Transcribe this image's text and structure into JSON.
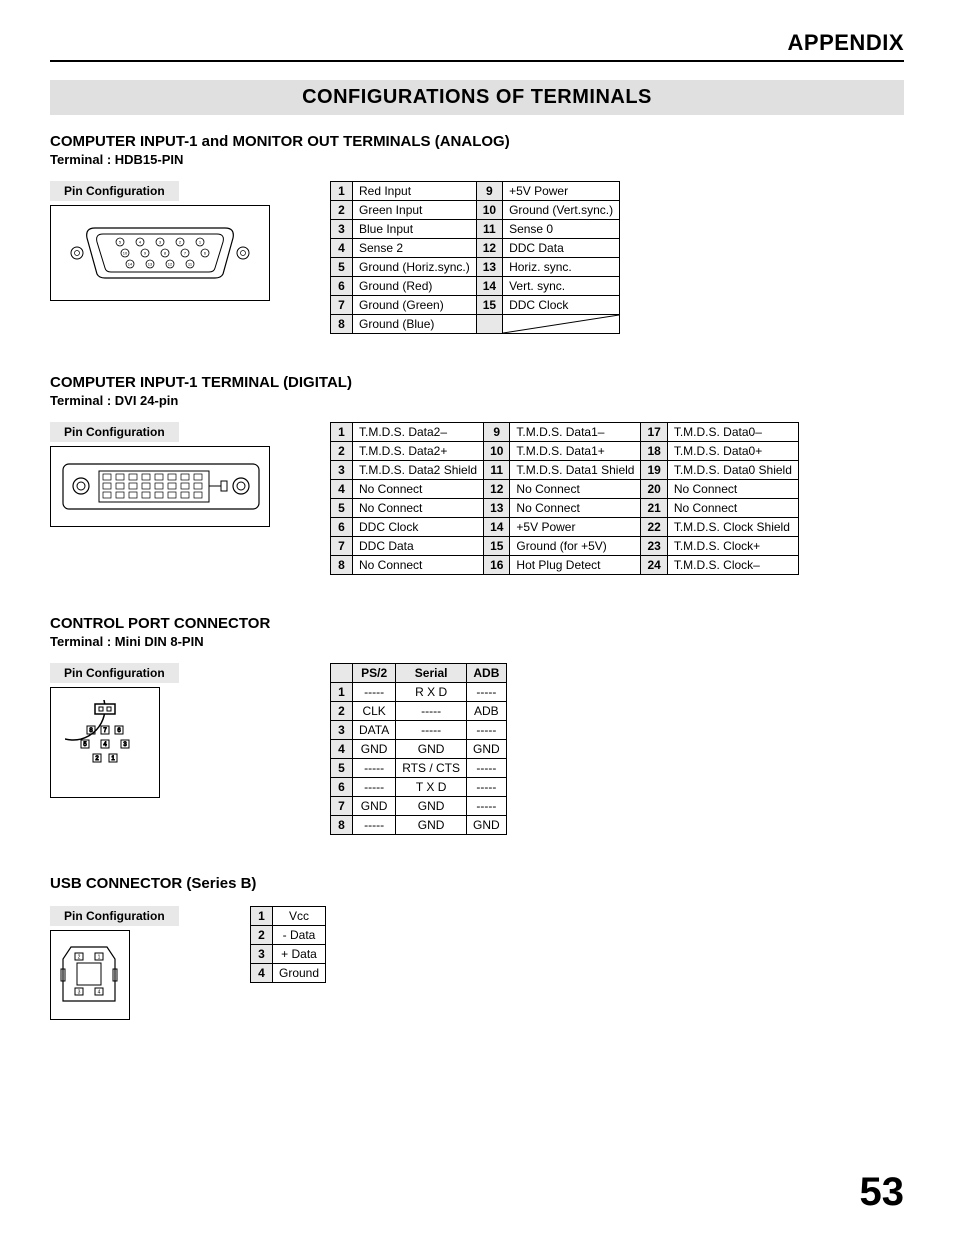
{
  "header": "APPENDIX",
  "main_title": "CONFIGURATIONS OF TERMINALS",
  "page_number": "53",
  "sections": {
    "analog": {
      "title": "COMPUTER INPUT-1 and MONITOR OUT TERMINALS (ANALOG)",
      "sub": "Terminal : HDB15-PIN",
      "config": "Pin Configuration",
      "pins_left": [
        {
          "n": "1",
          "v": "Red Input"
        },
        {
          "n": "2",
          "v": "Green Input"
        },
        {
          "n": "3",
          "v": "Blue Input"
        },
        {
          "n": "4",
          "v": "Sense 2"
        },
        {
          "n": "5",
          "v": "Ground (Horiz.sync.)"
        },
        {
          "n": "6",
          "v": "Ground (Red)"
        },
        {
          "n": "7",
          "v": "Ground (Green)"
        },
        {
          "n": "8",
          "v": "Ground (Blue)"
        }
      ],
      "pins_right": [
        {
          "n": "9",
          "v": "+5V Power"
        },
        {
          "n": "10",
          "v": "Ground (Vert.sync.)"
        },
        {
          "n": "11",
          "v": "Sense 0"
        },
        {
          "n": "12",
          "v": "DDC Data"
        },
        {
          "n": "13",
          "v": "Horiz. sync."
        },
        {
          "n": "14",
          "v": "Vert. sync."
        },
        {
          "n": "15",
          "v": "DDC Clock"
        }
      ]
    },
    "digital": {
      "title": "COMPUTER INPUT-1 TERMINAL (DIGITAL)",
      "sub": "Terminal : DVI 24-pin",
      "config": "Pin Configuration",
      "pins_a": [
        {
          "n": "1",
          "v": "T.M.D.S. Data2–"
        },
        {
          "n": "2",
          "v": "T.M.D.S. Data2+"
        },
        {
          "n": "3",
          "v": "T.M.D.S. Data2 Shield"
        },
        {
          "n": "4",
          "v": "No Connect"
        },
        {
          "n": "5",
          "v": "No Connect"
        },
        {
          "n": "6",
          "v": "DDC Clock"
        },
        {
          "n": "7",
          "v": "DDC Data"
        },
        {
          "n": "8",
          "v": "No Connect"
        }
      ],
      "pins_b": [
        {
          "n": "9",
          "v": "T.M.D.S. Data1–"
        },
        {
          "n": "10",
          "v": "T.M.D.S. Data1+"
        },
        {
          "n": "11",
          "v": "T.M.D.S. Data1 Shield"
        },
        {
          "n": "12",
          "v": "No Connect"
        },
        {
          "n": "13",
          "v": "No Connect"
        },
        {
          "n": "14",
          "v": "+5V Power"
        },
        {
          "n": "15",
          "v": "Ground (for +5V)"
        },
        {
          "n": "16",
          "v": "Hot Plug Detect"
        }
      ],
      "pins_c": [
        {
          "n": "17",
          "v": "T.M.D.S. Data0–"
        },
        {
          "n": "18",
          "v": "T.M.D.S. Data0+"
        },
        {
          "n": "19",
          "v": "T.M.D.S. Data0 Shield"
        },
        {
          "n": "20",
          "v": "No Connect"
        },
        {
          "n": "21",
          "v": "No Connect"
        },
        {
          "n": "22",
          "v": "T.M.D.S. Clock Shield"
        },
        {
          "n": "23",
          "v": "T.M.D.S. Clock+"
        },
        {
          "n": "24",
          "v": "T.M.D.S. Clock–"
        }
      ]
    },
    "control": {
      "title": "CONTROL PORT CONNECTOR",
      "sub": "Terminal : Mini DIN 8-PIN",
      "config": "Pin Configuration",
      "headers": [
        "",
        "PS/2",
        "Serial",
        "ADB"
      ],
      "rows": [
        {
          "n": "1",
          "ps2": "-----",
          "serial": "R X D",
          "adb": "-----"
        },
        {
          "n": "2",
          "ps2": "CLK",
          "serial": "-----",
          "adb": "ADB"
        },
        {
          "n": "3",
          "ps2": "DATA",
          "serial": "-----",
          "adb": "-----"
        },
        {
          "n": "4",
          "ps2": "GND",
          "serial": "GND",
          "adb": "GND"
        },
        {
          "n": "5",
          "ps2": "-----",
          "serial": "RTS / CTS",
          "adb": "-----"
        },
        {
          "n": "6",
          "ps2": "-----",
          "serial": "T X D",
          "adb": "-----"
        },
        {
          "n": "7",
          "ps2": "GND",
          "serial": "GND",
          "adb": "-----"
        },
        {
          "n": "8",
          "ps2": "-----",
          "serial": "GND",
          "adb": "GND"
        }
      ]
    },
    "usb": {
      "title": "USB CONNECTOR (Series B)",
      "config": "Pin Configuration",
      "rows": [
        {
          "n": "1",
          "v": "Vcc"
        },
        {
          "n": "2",
          "v": "- Data"
        },
        {
          "n": "3",
          "v": "+ Data"
        },
        {
          "n": "4",
          "v": "Ground"
        }
      ]
    }
  }
}
